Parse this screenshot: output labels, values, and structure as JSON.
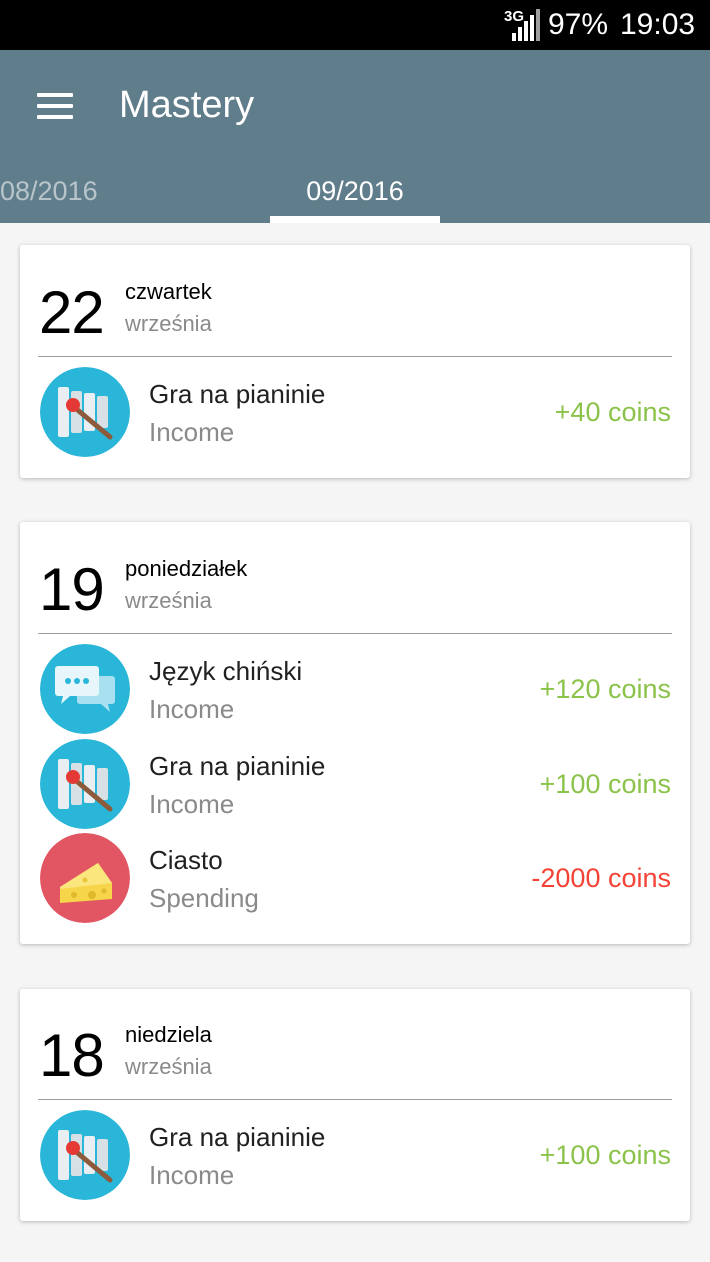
{
  "status_bar": {
    "network": "3G",
    "battery": "97%",
    "time": "19:03"
  },
  "app_bar": {
    "title": "Mastery"
  },
  "tabs": {
    "previous": "08/2016",
    "current": "09/2016"
  },
  "days": [
    {
      "day": "22",
      "weekday": "czwartek",
      "month": "września",
      "entries": [
        {
          "title": "Gra na pianinie",
          "type": "Income",
          "amount": "+40 coins",
          "icon": "xylophone-icon"
        }
      ]
    },
    {
      "day": "19",
      "weekday": "poniedziałek",
      "month": "września",
      "entries": [
        {
          "title": "Język chiński",
          "type": "Income",
          "amount": "+120 coins",
          "icon": "chat-bubbles-icon"
        },
        {
          "title": "Gra na pianinie",
          "type": "Income",
          "amount": "+100 coins",
          "icon": "xylophone-icon"
        },
        {
          "title": "Ciasto",
          "type": "Spending",
          "amount": "-2000 coins",
          "icon": "cheese-cake-icon"
        }
      ]
    },
    {
      "day": "18",
      "weekday": "niedziela",
      "month": "września",
      "entries": [
        {
          "title": "Gra na pianinie",
          "type": "Income",
          "amount": "+100 coins",
          "icon": "xylophone-icon"
        }
      ]
    }
  ],
  "colors": {
    "app_bar": "#607d8b",
    "income": "#8bc34a",
    "spending": "#f44336",
    "icon_blue": "#29b6d8",
    "icon_red": "#e25563"
  }
}
